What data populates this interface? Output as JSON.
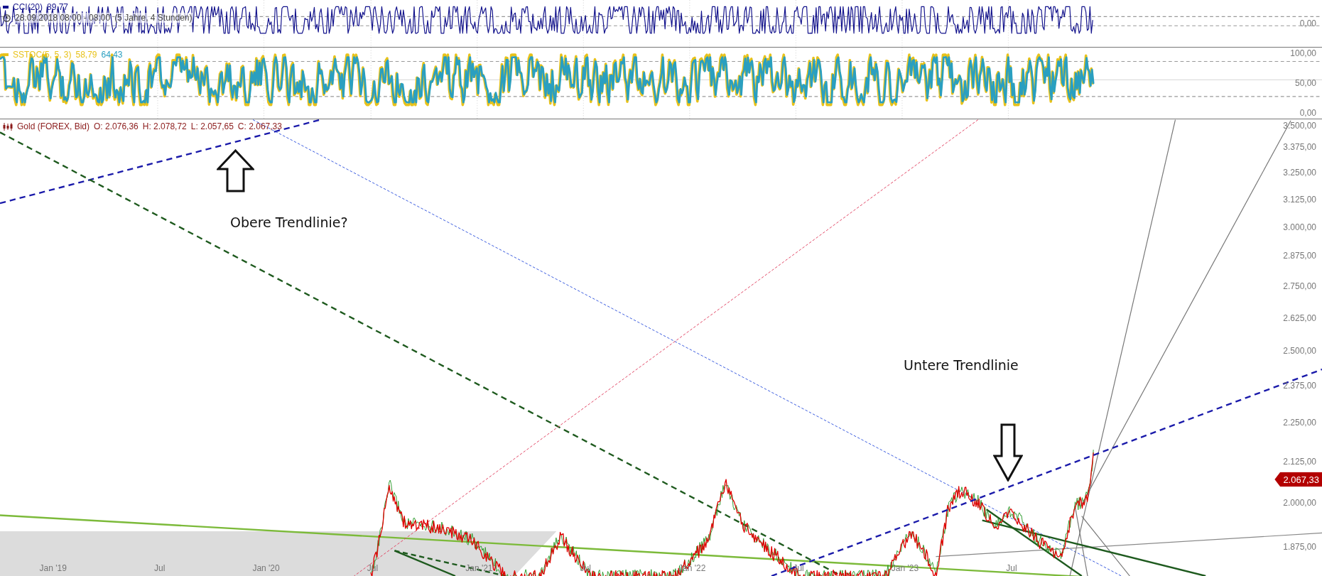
{
  "cci_panel": {
    "legend": {
      "name": "CCI(20)",
      "value": "89,77"
    },
    "period": {
      "range": "28.09.2018 08:00 - 08:00",
      "span": "(5 Jahre, 4 Stunden)"
    },
    "axis_labels": [
      "0,00"
    ]
  },
  "sstoc_panel": {
    "legend": {
      "name": "SSTOC(5, 5, 3)",
      "values": [
        {
          "text": "58,79",
          "color": "#e8c21a"
        },
        {
          "text": "64,43",
          "color": "#2a9fc0"
        }
      ]
    },
    "axis_labels": [
      "100,00",
      "50,00",
      "0,00"
    ]
  },
  "main_chart": {
    "legend": {
      "instrument": "Gold (FOREX, Bid)",
      "quotes": [
        "O: 2.076,36",
        "H: 2.078,72",
        "L: 2.057,65",
        "C: 2.067,33"
      ]
    },
    "price_axis": [
      "3.500,00",
      "3.375,00",
      "3.250,00",
      "3.125,00",
      "3.000,00",
      "2.875,00",
      "2.750,00",
      "2.625,00",
      "2.500,00",
      "2.375,00",
      "2.250,00",
      "2.125,00",
      "2.000,00",
      "1.875,00"
    ],
    "last_price": "2.067,33",
    "time_axis": [
      "Jan '19",
      "Jul",
      "Jan '20",
      "Jul",
      "Jan '21",
      "Jul",
      "Jan '22",
      "Jul",
      "Jan '23",
      "Jul"
    ],
    "annotations": [
      {
        "text": "Obere Trendlinie?",
        "kind": "up"
      },
      {
        "text": "Untere Trendlinie",
        "kind": "down"
      }
    ]
  }
}
